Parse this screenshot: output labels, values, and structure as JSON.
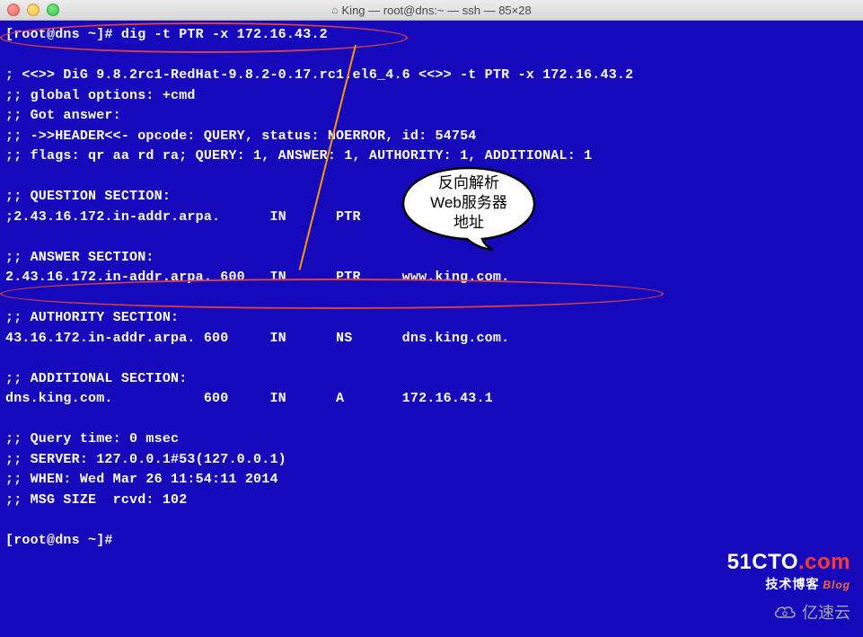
{
  "window": {
    "title": "King — root@dns:~ — ssh — 85×28"
  },
  "terminal": {
    "lines": [
      "[root@dns ~]# dig -t PTR -x 172.16.43.2",
      "",
      "; <<>> DiG 9.8.2rc1-RedHat-9.8.2-0.17.rc1.el6_4.6 <<>> -t PTR -x 172.16.43.2",
      ";; global options: +cmd",
      ";; Got answer:",
      ";; ->>HEADER<<- opcode: QUERY, status: NOERROR, id: 54754",
      ";; flags: qr aa rd ra; QUERY: 1, ANSWER: 1, AUTHORITY: 1, ADDITIONAL: 1",
      "",
      ";; QUESTION SECTION:",
      ";2.43.16.172.in-addr.arpa.      IN      PTR",
      "",
      ";; ANSWER SECTION:",
      "2.43.16.172.in-addr.arpa. 600   IN      PTR     www.king.com.",
      "",
      ";; AUTHORITY SECTION:",
      "43.16.172.in-addr.arpa. 600     IN      NS      dns.king.com.",
      "",
      ";; ADDITIONAL SECTION:",
      "dns.king.com.           600     IN      A       172.16.43.1",
      "",
      ";; Query time: 0 msec",
      ";; SERVER: 127.0.0.1#53(127.0.0.1)",
      ";; WHEN: Wed Mar 26 11:54:11 2014",
      ";; MSG SIZE  rcvd: 102",
      "",
      "[root@dns ~]# "
    ]
  },
  "annotation": {
    "bubble_line1": "反向解析",
    "bubble_line2": "Web服务器",
    "bubble_line3": "地址"
  },
  "watermarks": {
    "cto_a": "51CTO",
    "cto_b": ".com",
    "cto_sub": "技术博客",
    "cto_blog": "Blog",
    "yisu": "亿速云"
  }
}
